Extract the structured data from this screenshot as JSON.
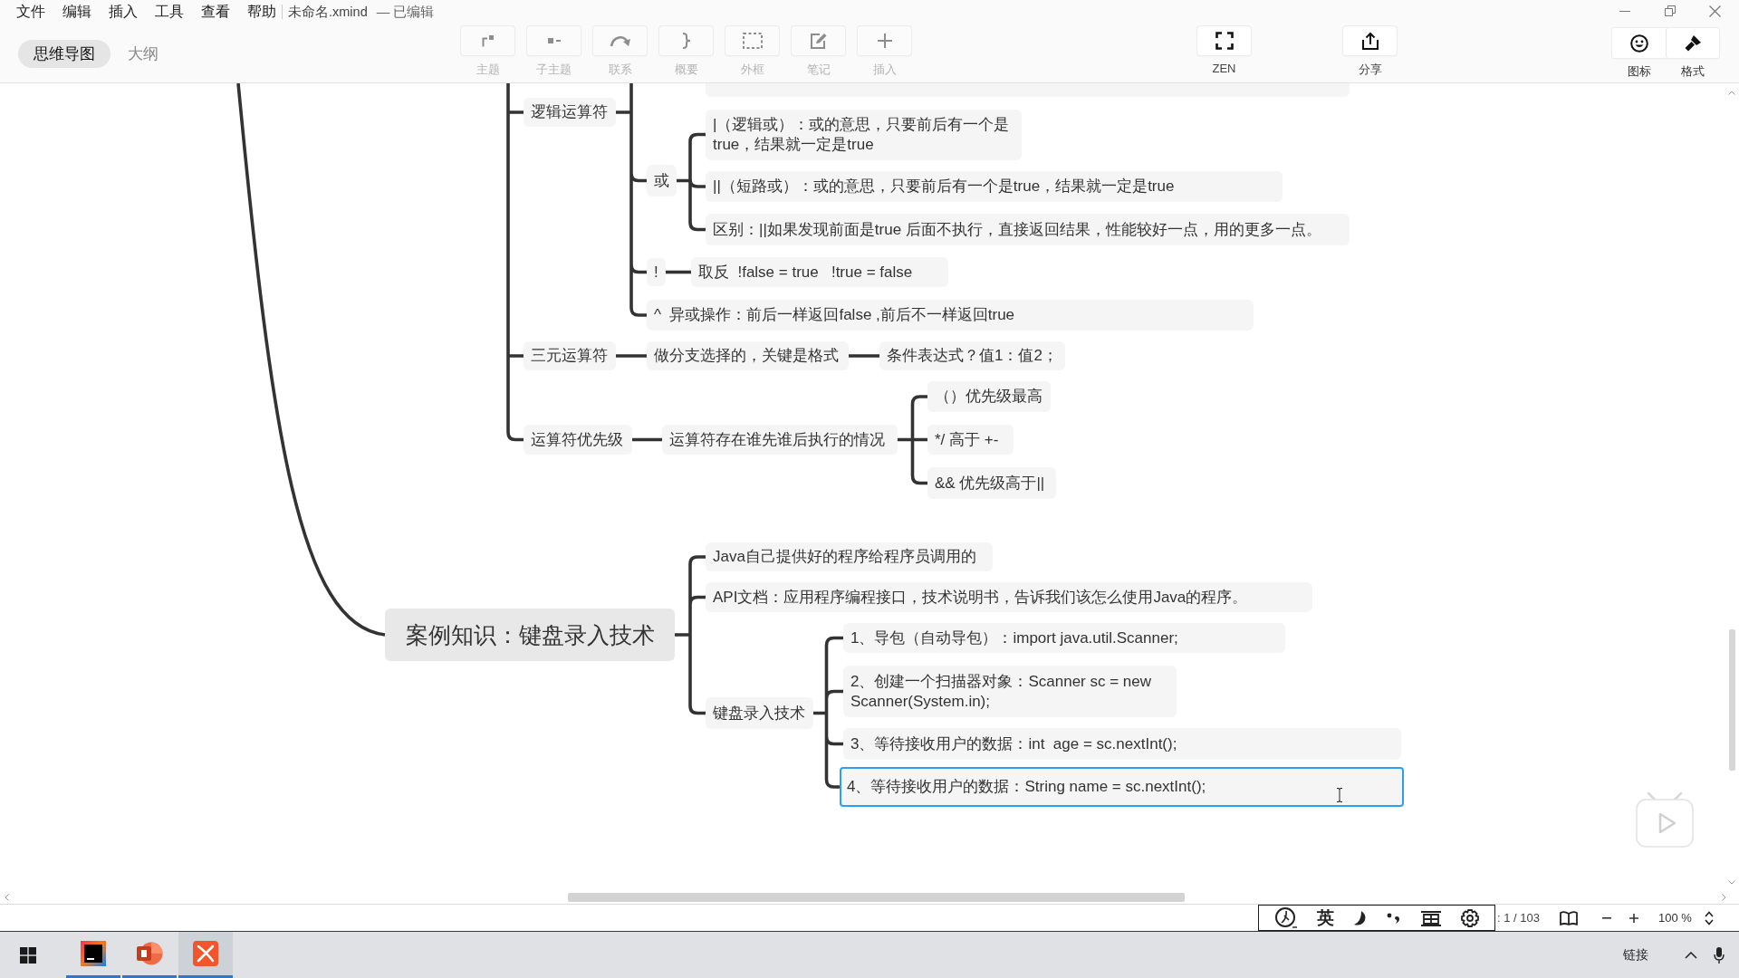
{
  "menu": [
    "文件",
    "编辑",
    "插入",
    "工具",
    "查看",
    "帮助"
  ],
  "document": {
    "name": "未命名.xmind",
    "status": "— 已编辑"
  },
  "view_tabs": [
    {
      "label": "思维导图",
      "selected": true
    },
    {
      "label": "大纲",
      "selected": false
    }
  ],
  "toolbar": [
    {
      "kind": "topic",
      "label": "主题",
      "disabled": true
    },
    {
      "kind": "subtopic",
      "label": "子主题",
      "disabled": true
    },
    {
      "kind": "relationship",
      "label": "联系",
      "disabled": true
    },
    {
      "kind": "summary",
      "label": "概要",
      "disabled": true
    },
    {
      "kind": "boundary",
      "label": "外框",
      "disabled": true
    },
    {
      "kind": "note",
      "label": "笔记",
      "disabled": true
    },
    {
      "kind": "insert",
      "label": "插入",
      "disabled": true
    }
  ],
  "zen_button": {
    "label": "ZEN",
    "disabled": false
  },
  "share_button": {
    "label": "分享",
    "disabled": false
  },
  "panel_buttons": [
    {
      "kind": "icons",
      "label": "图标"
    },
    {
      "kind": "format",
      "label": "格式"
    }
  ],
  "mind_map": {
    "upper_topics": [
      {
        "text": "逻辑运算符",
        "selected": false,
        "children": [
          {
            "text": "或",
            "selected": false,
            "children": [
              {
                "text": "|（逻辑或）：或的意思，只要前后有一个是 true，结果就一定是true",
                "selected": false
              },
              {
                "text": "||（短路或）：或的意思，只要前后有一个是true，结果就一定是true",
                "selected": false
              },
              {
                "text": "区别：||如果发现前面是true 后面不执行，直接返回结果，性能较好一点，用的更多一点。",
                "selected": false
              }
            ]
          },
          {
            "text": "!",
            "selected": false,
            "children": [
              {
                "text": "取反  !false = true   !true = false",
                "selected": false
              }
            ]
          },
          {
            "text": "^  异或操作：前后一样返回false ,前后不一样返回true",
            "selected": false
          }
        ]
      },
      {
        "text": "三元运算符",
        "selected": false,
        "children": [
          {
            "text": "做分支选择的，关键是格式",
            "selected": false,
            "children": [
              {
                "text": "条件表达式？值1：值2；",
                "selected": false
              }
            ]
          }
        ]
      },
      {
        "text": "运算符优先级",
        "selected": false,
        "children": [
          {
            "text": "运算符存在谁先谁后执行的情况",
            "selected": false,
            "children": [
              {
                "text": "（）优先级最高",
                "selected": false
              },
              {
                "text": "*/ 高于 +-",
                "selected": false
              },
              {
                "text": "&& 优先级高于||",
                "selected": false
              }
            ]
          }
        ]
      }
    ],
    "main_topic": {
      "text": "案例知识：键盘录入技术",
      "selected": false,
      "children": [
        {
          "text": "Java自己提供好的程序给程序员调用的",
          "selected": false
        },
        {
          "text": "API文档：应用程序编程接口，技术说明书，告诉我们该怎么使用Java的程序。",
          "selected": false
        },
        {
          "text": "键盘录入技术",
          "selected": false,
          "children": [
            {
              "text": "1、导包（自动导包）：import java.util.Scanner;",
              "selected": false
            },
            {
              "text": "2、创建一个扫描器对象：Scanner sc = new Scanner(System.in);",
              "selected": false
            },
            {
              "text": "3、等待接收用户的数据：int  age = sc.nextInt();",
              "selected": false
            },
            {
              "text": "4、等待接收用户的数据：String name = sc.nextInt();",
              "selected": true
            }
          ]
        }
      ]
    }
  },
  "status_bar": {
    "input_mode": "英",
    "page_count": ": 1 / 103",
    "zoom": "100 %"
  },
  "taskbar": {
    "apps": [
      {
        "kind": "ide",
        "selected": false
      },
      {
        "kind": "slides",
        "selected": false
      },
      {
        "kind": "mindmap",
        "selected": true
      }
    ],
    "tray_text": "链接"
  }
}
